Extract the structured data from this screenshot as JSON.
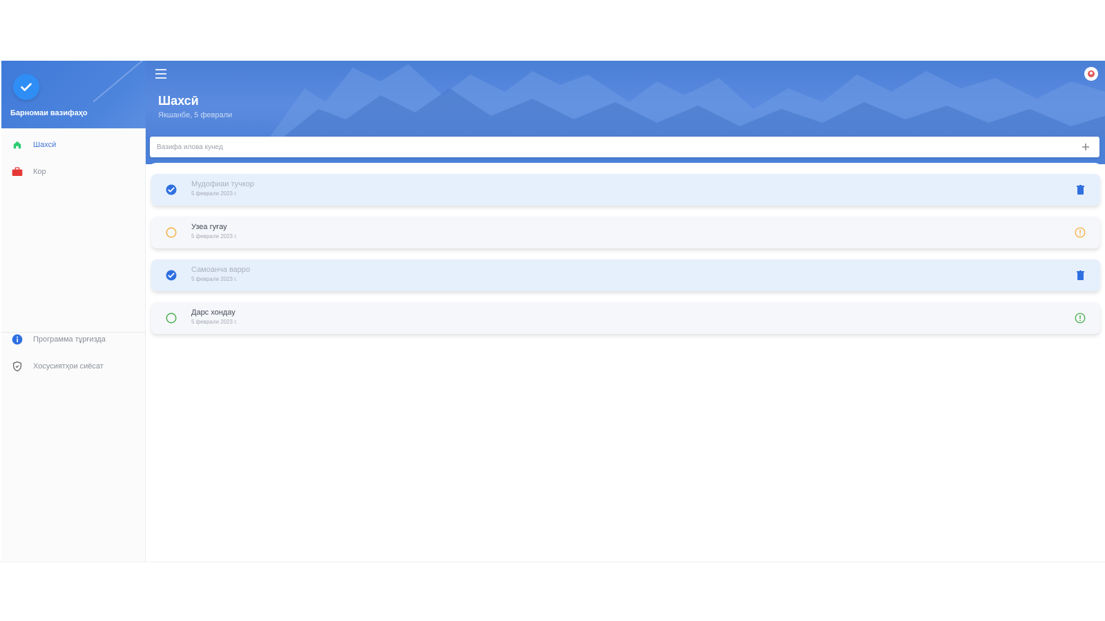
{
  "app": {
    "title": "Барномаи вазифаҳо"
  },
  "sidebar": {
    "items": [
      {
        "label": "Шахсӣ",
        "icon": "home-icon",
        "color": "#2ecc71",
        "active": true
      },
      {
        "label": "Кор",
        "icon": "briefcase-icon",
        "color": "#e53935",
        "active": false
      }
    ],
    "footer_items": [
      {
        "label": "Программа тұрғизда",
        "icon": "info-icon",
        "color": "#2f6fe0"
      },
      {
        "label": "Хосусиятҳои сиёсат",
        "icon": "shield-icon",
        "color": "#666666"
      }
    ]
  },
  "header": {
    "title": "Шахсӣ",
    "date": "Якшанбе, 5 феврали"
  },
  "search": {
    "placeholder": "Вазифа илова кунед",
    "add_icon": "plus-icon"
  },
  "tasks": [
    {
      "title": "Мудофиаи тучкор",
      "date": "5 феврали 2023 г.",
      "done": true,
      "color": "#2f6fe0",
      "action_icon": "trash-icon"
    },
    {
      "title": "Узеа гуғау",
      "date": "5 феврали 2023 г.",
      "done": false,
      "color": "#f5b041",
      "action_icon": "alert-icon"
    },
    {
      "title": "Самоанча варро",
      "date": "5 феврали 2023 г.",
      "done": true,
      "color": "#2f6fe0",
      "action_icon": "trash-icon"
    },
    {
      "title": "Дарс хондау",
      "date": "5 феврали 2023 г.",
      "done": false,
      "color": "#4caf50",
      "action_icon": "alert-icon"
    }
  ],
  "colors": {
    "accent": "#4a80d8",
    "done_bg": "#e6f0fc",
    "todo_bg": "#f6f7fb"
  }
}
